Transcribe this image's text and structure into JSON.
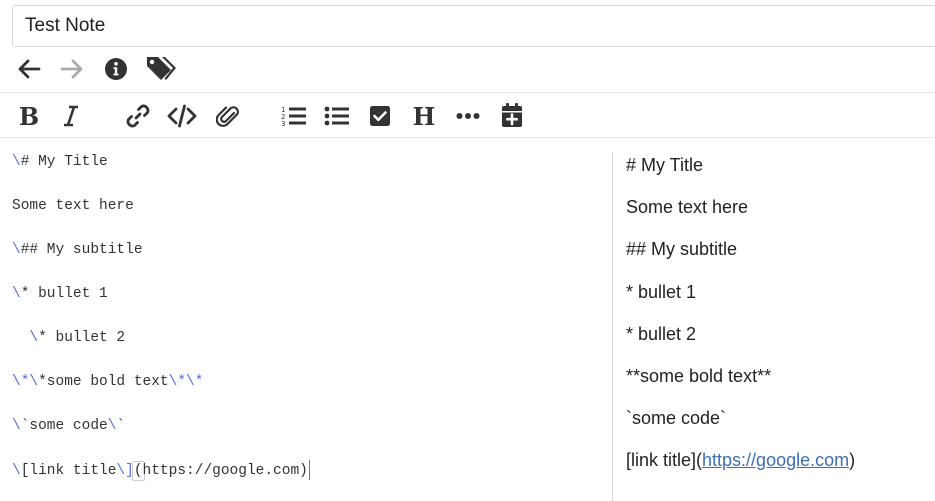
{
  "note": {
    "title": "Test Note"
  },
  "nav": {
    "icons": [
      "arrow-left-icon",
      "arrow-right-icon",
      "info-icon",
      "tags-icon"
    ],
    "colors": {
      "active": "#333333",
      "disabled": "#aaaaaa"
    }
  },
  "toolbar": {
    "icons": [
      "bold-icon",
      "italic-icon",
      "link-icon",
      "code-icon",
      "paperclip-icon",
      "ordered-list-icon",
      "bullet-list-icon",
      "checkbox-icon",
      "heading-icon",
      "ellipsis-icon",
      "calendar-plus-icon"
    ],
    "bold_label": "B",
    "heading_label": "H"
  },
  "editor": {
    "lines": [
      {
        "esc": "\\",
        "text": "# My Title"
      },
      {
        "text": "Some text here"
      },
      {
        "esc": "\\",
        "text": "## My subtitle"
      },
      {
        "esc": "\\",
        "text": "* bullet 1"
      },
      {
        "lead": "  ",
        "esc": "\\",
        "text": "* bullet 2"
      },
      {
        "esc": "\\*\\",
        "text": "*some bold text",
        "esc2": "\\*\\",
        "tail": "*"
      },
      {
        "esc": "\\",
        "text": "`some code",
        "esc2": "\\",
        "tail": "`"
      },
      {
        "esc": "\\",
        "text": "[link title",
        "esc2": "\\",
        "tail": "]",
        "paren": "(",
        "rest": "https://google.com)"
      }
    ]
  },
  "preview": {
    "lines": [
      "# My Title",
      "Some text here",
      "## My subtitle",
      "* bullet 1",
      "* bullet 2",
      "**some bold text**",
      "`some code`"
    ],
    "link": {
      "before": "[link title](",
      "url": "https://google.com",
      "after": ")"
    },
    "link_color": "#3b6fb6"
  },
  "colors": {
    "markdown_escape": "#5b6ee1",
    "divider": "#d9d9d9"
  }
}
